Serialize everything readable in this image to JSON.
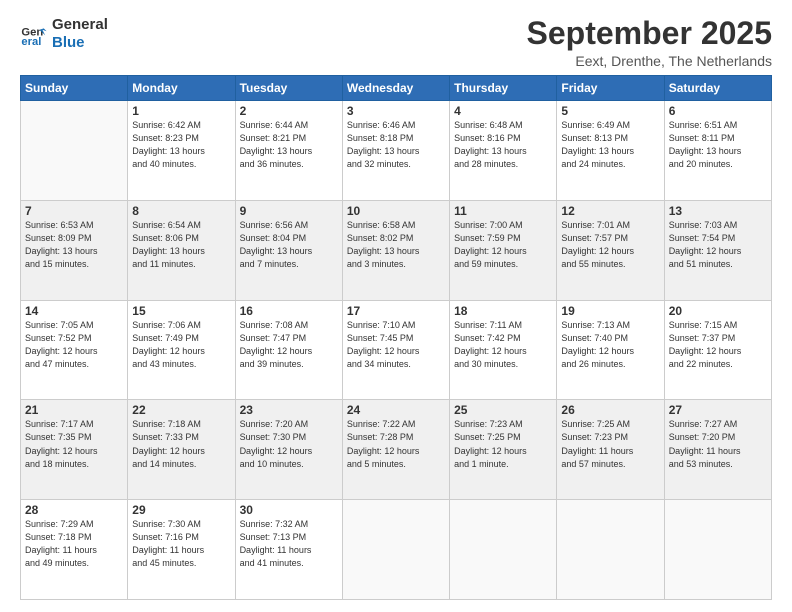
{
  "logo": {
    "text_general": "General",
    "text_blue": "Blue"
  },
  "header": {
    "month": "September 2025",
    "location": "Eext, Drenthe, The Netherlands"
  },
  "weekdays": [
    "Sunday",
    "Monday",
    "Tuesday",
    "Wednesday",
    "Thursday",
    "Friday",
    "Saturday"
  ],
  "weeks": [
    [
      {
        "day": "",
        "info": ""
      },
      {
        "day": "1",
        "info": "Sunrise: 6:42 AM\nSunset: 8:23 PM\nDaylight: 13 hours\nand 40 minutes."
      },
      {
        "day": "2",
        "info": "Sunrise: 6:44 AM\nSunset: 8:21 PM\nDaylight: 13 hours\nand 36 minutes."
      },
      {
        "day": "3",
        "info": "Sunrise: 6:46 AM\nSunset: 8:18 PM\nDaylight: 13 hours\nand 32 minutes."
      },
      {
        "day": "4",
        "info": "Sunrise: 6:48 AM\nSunset: 8:16 PM\nDaylight: 13 hours\nand 28 minutes."
      },
      {
        "day": "5",
        "info": "Sunrise: 6:49 AM\nSunset: 8:13 PM\nDaylight: 13 hours\nand 24 minutes."
      },
      {
        "day": "6",
        "info": "Sunrise: 6:51 AM\nSunset: 8:11 PM\nDaylight: 13 hours\nand 20 minutes."
      }
    ],
    [
      {
        "day": "7",
        "info": "Sunrise: 6:53 AM\nSunset: 8:09 PM\nDaylight: 13 hours\nand 15 minutes."
      },
      {
        "day": "8",
        "info": "Sunrise: 6:54 AM\nSunset: 8:06 PM\nDaylight: 13 hours\nand 11 minutes."
      },
      {
        "day": "9",
        "info": "Sunrise: 6:56 AM\nSunset: 8:04 PM\nDaylight: 13 hours\nand 7 minutes."
      },
      {
        "day": "10",
        "info": "Sunrise: 6:58 AM\nSunset: 8:02 PM\nDaylight: 13 hours\nand 3 minutes."
      },
      {
        "day": "11",
        "info": "Sunrise: 7:00 AM\nSunset: 7:59 PM\nDaylight: 12 hours\nand 59 minutes."
      },
      {
        "day": "12",
        "info": "Sunrise: 7:01 AM\nSunset: 7:57 PM\nDaylight: 12 hours\nand 55 minutes."
      },
      {
        "day": "13",
        "info": "Sunrise: 7:03 AM\nSunset: 7:54 PM\nDaylight: 12 hours\nand 51 minutes."
      }
    ],
    [
      {
        "day": "14",
        "info": "Sunrise: 7:05 AM\nSunset: 7:52 PM\nDaylight: 12 hours\nand 47 minutes."
      },
      {
        "day": "15",
        "info": "Sunrise: 7:06 AM\nSunset: 7:49 PM\nDaylight: 12 hours\nand 43 minutes."
      },
      {
        "day": "16",
        "info": "Sunrise: 7:08 AM\nSunset: 7:47 PM\nDaylight: 12 hours\nand 39 minutes."
      },
      {
        "day": "17",
        "info": "Sunrise: 7:10 AM\nSunset: 7:45 PM\nDaylight: 12 hours\nand 34 minutes."
      },
      {
        "day": "18",
        "info": "Sunrise: 7:11 AM\nSunset: 7:42 PM\nDaylight: 12 hours\nand 30 minutes."
      },
      {
        "day": "19",
        "info": "Sunrise: 7:13 AM\nSunset: 7:40 PM\nDaylight: 12 hours\nand 26 minutes."
      },
      {
        "day": "20",
        "info": "Sunrise: 7:15 AM\nSunset: 7:37 PM\nDaylight: 12 hours\nand 22 minutes."
      }
    ],
    [
      {
        "day": "21",
        "info": "Sunrise: 7:17 AM\nSunset: 7:35 PM\nDaylight: 12 hours\nand 18 minutes."
      },
      {
        "day": "22",
        "info": "Sunrise: 7:18 AM\nSunset: 7:33 PM\nDaylight: 12 hours\nand 14 minutes."
      },
      {
        "day": "23",
        "info": "Sunrise: 7:20 AM\nSunset: 7:30 PM\nDaylight: 12 hours\nand 10 minutes."
      },
      {
        "day": "24",
        "info": "Sunrise: 7:22 AM\nSunset: 7:28 PM\nDaylight: 12 hours\nand 5 minutes."
      },
      {
        "day": "25",
        "info": "Sunrise: 7:23 AM\nSunset: 7:25 PM\nDaylight: 12 hours\nand 1 minute."
      },
      {
        "day": "26",
        "info": "Sunrise: 7:25 AM\nSunset: 7:23 PM\nDaylight: 11 hours\nand 57 minutes."
      },
      {
        "day": "27",
        "info": "Sunrise: 7:27 AM\nSunset: 7:20 PM\nDaylight: 11 hours\nand 53 minutes."
      }
    ],
    [
      {
        "day": "28",
        "info": "Sunrise: 7:29 AM\nSunset: 7:18 PM\nDaylight: 11 hours\nand 49 minutes."
      },
      {
        "day": "29",
        "info": "Sunrise: 7:30 AM\nSunset: 7:16 PM\nDaylight: 11 hours\nand 45 minutes."
      },
      {
        "day": "30",
        "info": "Sunrise: 7:32 AM\nSunset: 7:13 PM\nDaylight: 11 hours\nand 41 minutes."
      },
      {
        "day": "",
        "info": ""
      },
      {
        "day": "",
        "info": ""
      },
      {
        "day": "",
        "info": ""
      },
      {
        "day": "",
        "info": ""
      }
    ]
  ]
}
